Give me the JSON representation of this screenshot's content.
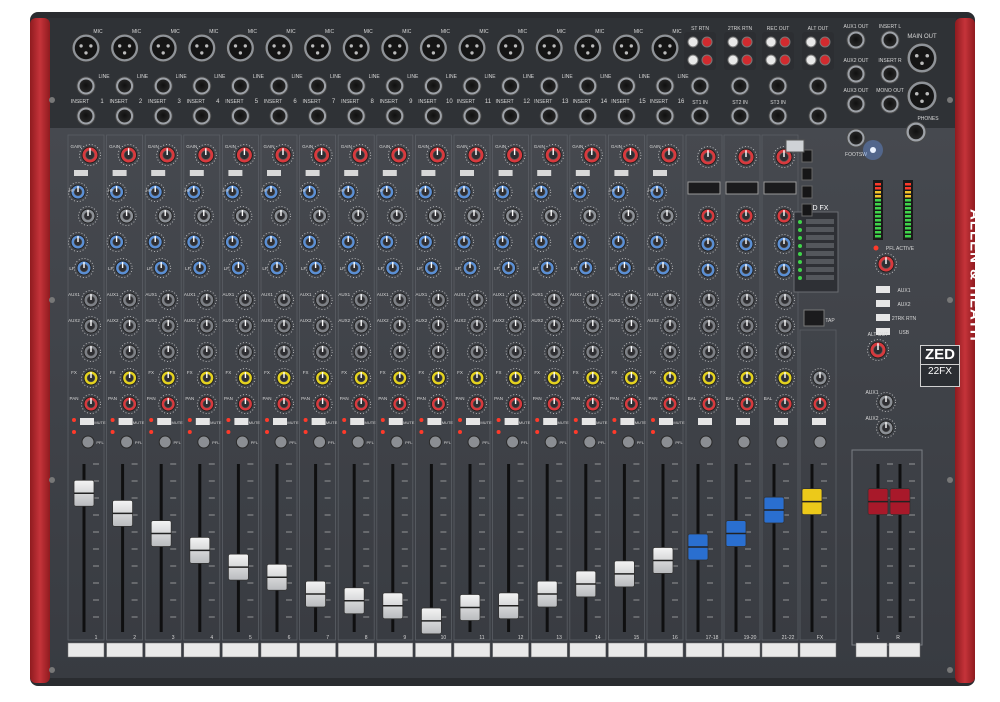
{
  "brand_label": "ALLEN & HEATH",
  "model": {
    "line1": "ZED",
    "line2": "22FX"
  },
  "fx_logo": "ZED FX",
  "mono_channels": [
    "1",
    "2",
    "3",
    "4",
    "5",
    "6",
    "7",
    "8",
    "9",
    "10",
    "11",
    "12",
    "13",
    "14",
    "15",
    "16"
  ],
  "stereo_channels": [
    "17-18",
    "19-20",
    "21-22"
  ],
  "fx_label": "FX",
  "master_labels": [
    "L",
    "R"
  ],
  "top_labels": {
    "mic": "MIC",
    "line": "LINE",
    "insert": "INSERT"
  },
  "strip_labels": {
    "gain": "GAIN",
    "hf": "HF",
    "mid": "MID",
    "freq": "FREQ",
    "lf": "LF",
    "aux1": "AUX1",
    "aux2": "AUX2",
    "aux3": "AUX3",
    "fx": "FX",
    "pan": "PAN",
    "bal": "BAL",
    "mute": "MUTE",
    "pfl": "PFL"
  },
  "right_labels": [
    "ST RTN",
    "2TRK RTN",
    "REC OUT",
    "ALT OUT",
    "AUX1 OUT",
    "AUX2 OUT",
    "AUX3 OUT",
    "INSERT L",
    "INSERT R",
    "MAIN OUT",
    "MONO OUT",
    "FX OUT",
    "ST1 IN",
    "ST2 IN",
    "ST3 IN",
    "FOOTSW",
    "PHONES",
    "PFL ACTIVE",
    "TAP",
    "AUX1",
    "AUX2",
    "ALT OUT",
    "2TRK RTN",
    "USB"
  ],
  "fader_levels": [
    0.82,
    0.7,
    0.58,
    0.48,
    0.38,
    0.32,
    0.22,
    0.18,
    0.15,
    0.06,
    0.14,
    0.15,
    0.22,
    0.28,
    0.34,
    0.42,
    0.5,
    0.58,
    0.72,
    0.77,
    0.77,
    0.77
  ],
  "colors": {
    "panel": "#3e4147",
    "frame": "#2a2c30",
    "red_end": "#b8262b",
    "gain_knob": "#d83a3e",
    "eq_knob": "#5b8fd4",
    "aux_knob": "#7d8086",
    "fx_knob": "#e4d21f",
    "fader_white": "#e6e6e6",
    "fader_blue": "#2a6fd0",
    "fader_yellow": "#ecc91a",
    "fader_red": "#a8192a"
  }
}
